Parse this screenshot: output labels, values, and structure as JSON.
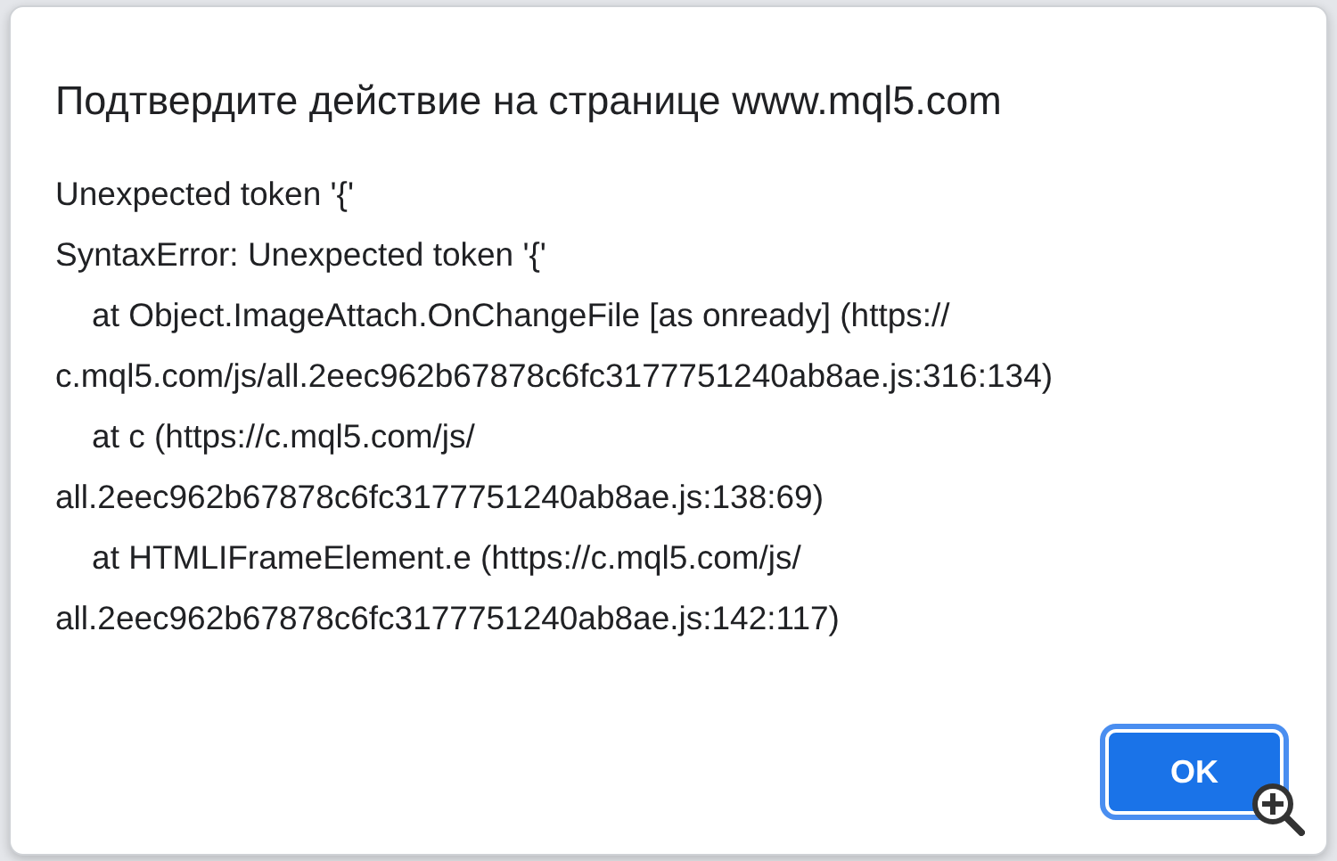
{
  "dialog": {
    "title": "Подтвердите действие на странице www.mql5.com",
    "message_lines": [
      "Unexpected token '{'",
      "SyntaxError: Unexpected token '{'",
      "    at Object.ImageAttach.OnChangeFile [as onready] (https://",
      "c.mql5.com/js/all.2eec962b67878c6fc3177751240ab8ae.js:316:134)",
      "    at c (https://c.mql5.com/js/",
      "all.2eec962b67878c6fc3177751240ab8ae.js:138:69)",
      "    at HTMLIFrameElement.e (https://c.mql5.com/js/",
      "all.2eec962b67878c6fc3177751240ab8ae.js:142:117)"
    ],
    "buttons": [
      {
        "label": "OK",
        "focused": true
      }
    ]
  }
}
